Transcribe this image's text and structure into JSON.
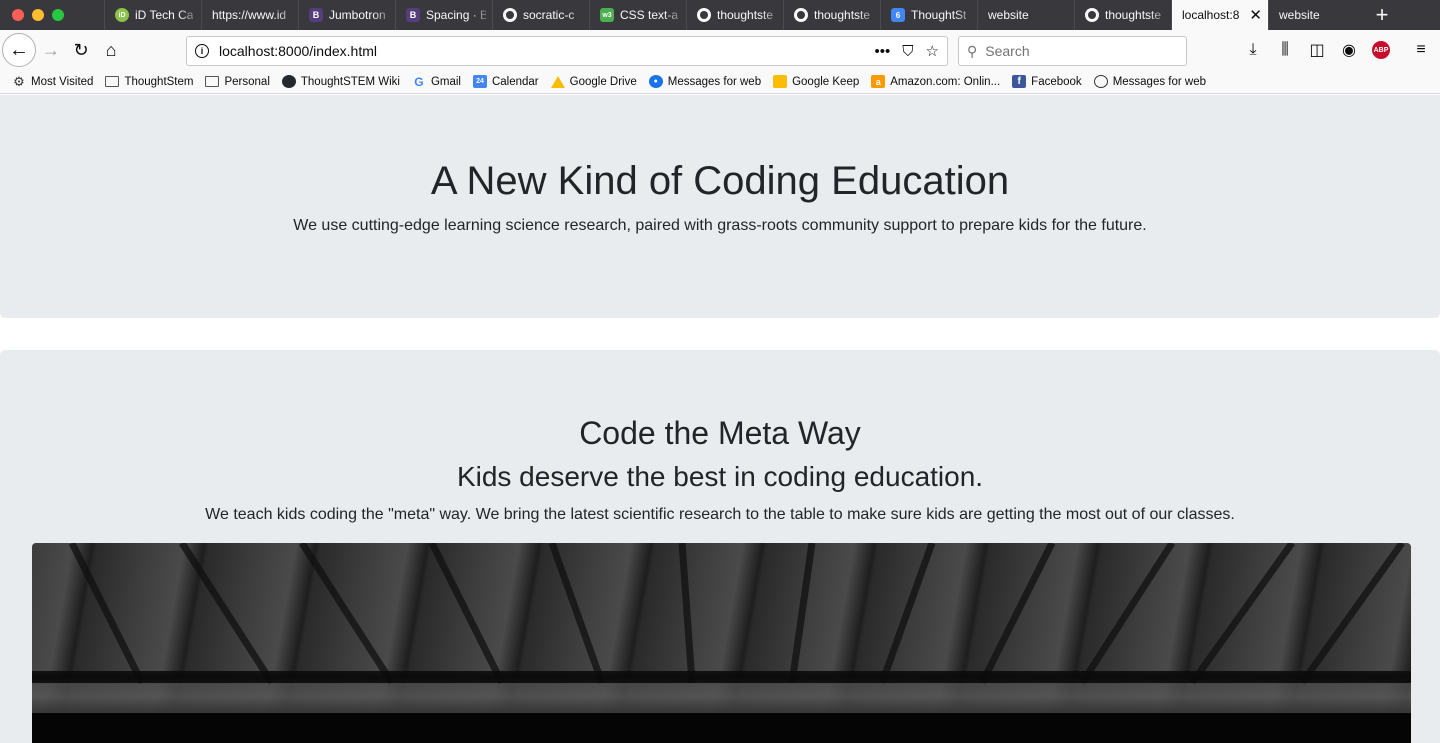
{
  "browser": {
    "tabs": [
      {
        "label": "iD Tech Ca",
        "icon": "id-tech-favicon"
      },
      {
        "label": "https://www.id",
        "icon": "none"
      },
      {
        "label": "Jumbotron",
        "icon": "bootstrap-favicon"
      },
      {
        "label": "Spacing · B",
        "icon": "bootstrap-favicon"
      },
      {
        "label": "socratic-c",
        "icon": "github-favicon"
      },
      {
        "label": "CSS text-a",
        "icon": "w3schools-favicon"
      },
      {
        "label": "thoughtste",
        "icon": "github-favicon"
      },
      {
        "label": "thoughtste",
        "icon": "github-favicon"
      },
      {
        "label": "ThoughtSt",
        "icon": "calendar-favicon"
      },
      {
        "label": "website",
        "icon": "none"
      },
      {
        "label": "thoughtste",
        "icon": "github-favicon"
      },
      {
        "label": "localhost:8",
        "icon": "none",
        "active": true
      },
      {
        "label": "website",
        "icon": "none"
      }
    ],
    "url": "localhost:8000/index.html",
    "search_placeholder": "Search",
    "bookmarks": [
      {
        "label": "Most Visited",
        "icon": "gear-icon"
      },
      {
        "label": "ThoughtStem",
        "icon": "folder-icon"
      },
      {
        "label": "Personal",
        "icon": "folder-icon"
      },
      {
        "label": "ThoughtSTEM Wiki",
        "icon": "github-icon"
      },
      {
        "label": "Gmail",
        "icon": "google-icon"
      },
      {
        "label": "Calendar",
        "icon": "calendar-icon"
      },
      {
        "label": "Google Drive",
        "icon": "drive-icon"
      },
      {
        "label": "Messages for web",
        "icon": "messages-icon"
      },
      {
        "label": "Google Keep",
        "icon": "keep-icon"
      },
      {
        "label": "Amazon.com: Onlin...",
        "icon": "amazon-icon"
      },
      {
        "label": "Facebook",
        "icon": "facebook-icon"
      },
      {
        "label": "Messages for web",
        "icon": "globe-icon"
      }
    ]
  },
  "page": {
    "hero": {
      "title": "A New Kind of Coding Education",
      "lead": "We use cutting-edge learning science research, paired with grass-roots community support to prepare kids for the future."
    },
    "section": {
      "title": "Code the Meta Way",
      "subtitle": "Kids deserve the best in coding education.",
      "text": "We teach kids coding the \"meta\" way. We bring the latest scientific research to the table to make sure kids are getting the most out of our classes."
    }
  },
  "colors": {
    "jumbotron_bg": "#e9ecef",
    "text": "#212529",
    "tabstrip_bg": "#38383d"
  }
}
